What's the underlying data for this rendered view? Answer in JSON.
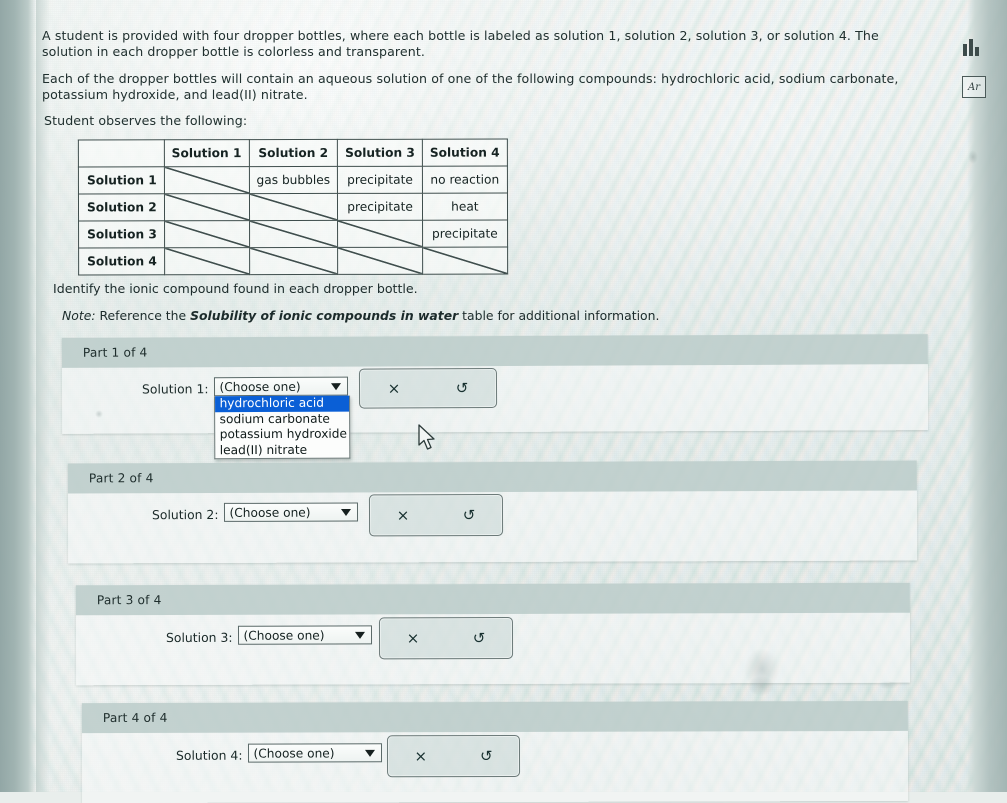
{
  "problem": {
    "paragraph1": "A student is provided with four dropper bottles, where each bottle is labeled as solution 1, solution 2, solution 3, or solution 4. The solution in each dropper bottle is colorless and transparent.",
    "paragraph2": "Each of the dropper bottles will contain an aqueous solution of one of the following compounds: hydrochloric acid, sodium carbonate, potassium hydroxide, and lead(II) nitrate.",
    "paragraph3": "Student observes the following:",
    "question": "Identify the ionic compound found in each dropper bottle.",
    "note_label": "Note:",
    "note_prefix": "Reference the",
    "note_bold": "Solubility of ionic compounds in water",
    "note_suffix": "table for additional information."
  },
  "observation_table": {
    "corner": "",
    "columns": [
      "Solution 1",
      "Solution 2",
      "Solution 3",
      "Solution 4"
    ],
    "rows": [
      {
        "header": "Solution 1",
        "cells": [
          "",
          "gas bubbles",
          "precipitate",
          "no reaction"
        ]
      },
      {
        "header": "Solution 2",
        "cells": [
          "",
          "",
          "precipitate",
          "heat"
        ]
      },
      {
        "header": "Solution 3",
        "cells": [
          "",
          "",
          "",
          "precipitate"
        ]
      },
      {
        "header": "Solution 4",
        "cells": [
          "",
          "",
          "",
          ""
        ]
      }
    ],
    "struck_cells": [
      [
        0,
        0
      ],
      [
        1,
        0
      ],
      [
        1,
        1
      ],
      [
        2,
        0
      ],
      [
        2,
        1
      ],
      [
        2,
        2
      ],
      [
        3,
        0
      ],
      [
        3,
        1
      ],
      [
        3,
        2
      ],
      [
        3,
        3
      ]
    ]
  },
  "parts": [
    {
      "header": "Part 1 of 4",
      "label": "Solution 1:",
      "select_value": "(Choose one)",
      "dropdown_open": true,
      "options": [
        "hydrochloric acid",
        "sodium carbonate",
        "potassium hydroxide",
        "lead(II) nitrate"
      ],
      "highlighted_option": "hydrochloric acid",
      "clear_icon": "×",
      "reset_icon": "↺"
    },
    {
      "header": "Part 2 of 4",
      "label": "Solution 2:",
      "select_value": "(Choose one)",
      "dropdown_open": false,
      "clear_icon": "×",
      "reset_icon": "↺"
    },
    {
      "header": "Part 3 of 4",
      "label": "Solution 3:",
      "select_value": "(Choose one)",
      "dropdown_open": false,
      "clear_icon": "×",
      "reset_icon": "↺"
    },
    {
      "header": "Part 4 of 4",
      "label": "Solution 4:",
      "select_value": "(Choose one)",
      "dropdown_open": false,
      "clear_icon": "×",
      "reset_icon": "↺"
    }
  ],
  "tools": {
    "chart_icon": "bar-chart-icon",
    "periodic_icon_label": "Ar"
  },
  "colors": {
    "highlight": "#0a5fd6",
    "panel_header": "#b0c4c1",
    "panel_body": "#f7faf9",
    "text": "#1c2b2b"
  }
}
